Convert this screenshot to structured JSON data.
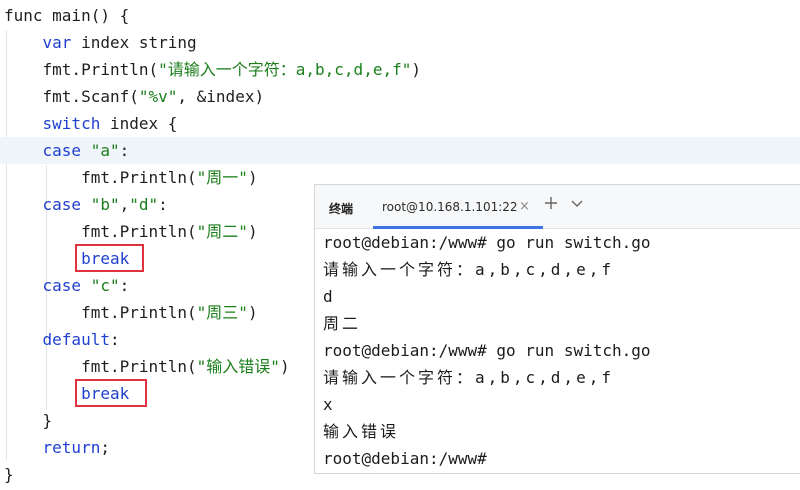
{
  "editor": {
    "lines": [
      {
        "parts": [
          {
            "t": "func main() {",
            "c": ""
          }
        ]
      },
      {
        "parts": [
          {
            "t": "    ",
            "c": ""
          },
          {
            "t": "var",
            "c": "kw"
          },
          {
            "t": " index string",
            "c": ""
          }
        ]
      },
      {
        "parts": [
          {
            "t": "    fmt.Println(",
            "c": ""
          },
          {
            "t": "\"请输入一个字符：a,b,c,d,e,f\"",
            "c": "str"
          },
          {
            "t": ")",
            "c": ""
          }
        ]
      },
      {
        "parts": [
          {
            "t": "    fmt.Scanf(",
            "c": ""
          },
          {
            "t": "\"%v\"",
            "c": "str"
          },
          {
            "t": ", &index)",
            "c": ""
          }
        ]
      },
      {
        "parts": [
          {
            "t": "    ",
            "c": ""
          },
          {
            "t": "switch",
            "c": "kw"
          },
          {
            "t": " index {",
            "c": ""
          }
        ]
      },
      {
        "parts": [
          {
            "t": "    ",
            "c": ""
          },
          {
            "t": "case",
            "c": "kw"
          },
          {
            "t": " ",
            "c": ""
          },
          {
            "t": "\"a\"",
            "c": "str"
          },
          {
            "t": ":",
            "c": ""
          }
        ]
      },
      {
        "parts": [
          {
            "t": "        fmt.Println(",
            "c": ""
          },
          {
            "t": "\"周一\"",
            "c": "str"
          },
          {
            "t": ")",
            "c": ""
          }
        ]
      },
      {
        "parts": [
          {
            "t": "    ",
            "c": ""
          },
          {
            "t": "case",
            "c": "kw"
          },
          {
            "t": " ",
            "c": ""
          },
          {
            "t": "\"b\"",
            "c": "str"
          },
          {
            "t": ",",
            "c": ""
          },
          {
            "t": "\"d\"",
            "c": "str"
          },
          {
            "t": ":",
            "c": ""
          }
        ]
      },
      {
        "parts": [
          {
            "t": "        fmt.Println(",
            "c": ""
          },
          {
            "t": "\"周二\"",
            "c": "str"
          },
          {
            "t": ")",
            "c": ""
          }
        ]
      },
      {
        "parts": [
          {
            "t": "        ",
            "c": ""
          },
          {
            "t": "break",
            "c": "kw"
          }
        ]
      },
      {
        "parts": [
          {
            "t": "    ",
            "c": ""
          },
          {
            "t": "case",
            "c": "kw"
          },
          {
            "t": " ",
            "c": ""
          },
          {
            "t": "\"c\"",
            "c": "str"
          },
          {
            "t": ":",
            "c": ""
          }
        ]
      },
      {
        "parts": [
          {
            "t": "        fmt.Println(",
            "c": ""
          },
          {
            "t": "\"周三\"",
            "c": "str"
          },
          {
            "t": ")",
            "c": ""
          }
        ]
      },
      {
        "parts": [
          {
            "t": "    ",
            "c": ""
          },
          {
            "t": "default",
            "c": "kw"
          },
          {
            "t": ":",
            "c": ""
          }
        ]
      },
      {
        "parts": [
          {
            "t": "        fmt.Println(",
            "c": ""
          },
          {
            "t": "\"输入错误\"",
            "c": "str"
          },
          {
            "t": ")",
            "c": ""
          }
        ]
      },
      {
        "parts": [
          {
            "t": "        ",
            "c": ""
          },
          {
            "t": "break",
            "c": "kw"
          }
        ]
      },
      {
        "parts": [
          {
            "t": "    }",
            "c": ""
          }
        ]
      },
      {
        "parts": [
          {
            "t": "    ",
            "c": ""
          },
          {
            "t": "return",
            "c": "kw"
          },
          {
            "t": ";",
            "c": ""
          }
        ]
      },
      {
        "parts": [
          {
            "t": "}",
            "c": ""
          }
        ]
      }
    ],
    "highlight_color": "#e0313f"
  },
  "terminal": {
    "title": "终端",
    "tab_label": "root@10.168.1.101:22",
    "tab_close": "×",
    "add_icon": "plus-icon",
    "more_icon": "chevron-down-icon",
    "lines": [
      "root@debian:/www# go run switch.go",
      "请输入一个字符：a,b,c,d,e,f",
      "d",
      "周二",
      "root@debian:/www# go run switch.go",
      "请输入一个字符：a,b,c,d,e,f",
      "x",
      "输入错误",
      "root@debian:/www#"
    ]
  }
}
